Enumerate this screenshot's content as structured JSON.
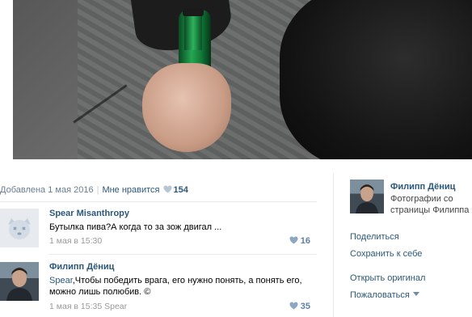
{
  "photo": {
    "icon": "photo-beer-bottle"
  },
  "meta": {
    "added": "Добавлена 1 мая 2016",
    "separator": "|",
    "like_label": "Мне нравится",
    "like_count": "154"
  },
  "comments": [
    {
      "author": "Spear Misanthropy",
      "avatar_icon": "default-avatar-icon",
      "text": "Бутылка пива?А когда то за зож двигал ...",
      "date": "1 мая в 15:30",
      "likes": "16"
    },
    {
      "author": "Филипп Дёниц",
      "avatar_icon": "user-avatar-photo",
      "mention": "Spear",
      "text": ",Чтобы победить врага, его нужно понять, а понять его, можно лишь полюбив. ©",
      "date": "1 мая в 15:35 Spear",
      "likes": "35"
    }
  ],
  "sidebar": {
    "owner_name": "Филипп Дёниц",
    "owner_sub": "Фотографии со страницы Филиппа",
    "actions": {
      "share": "Поделиться",
      "save": "Сохранить к себе",
      "open_original": "Открыть оригинал",
      "report": "Пожаловаться"
    }
  },
  "colors": {
    "link": "#2b587a",
    "muted": "#999999",
    "like": "#5f7fa0",
    "divider": "#e7eaed"
  }
}
